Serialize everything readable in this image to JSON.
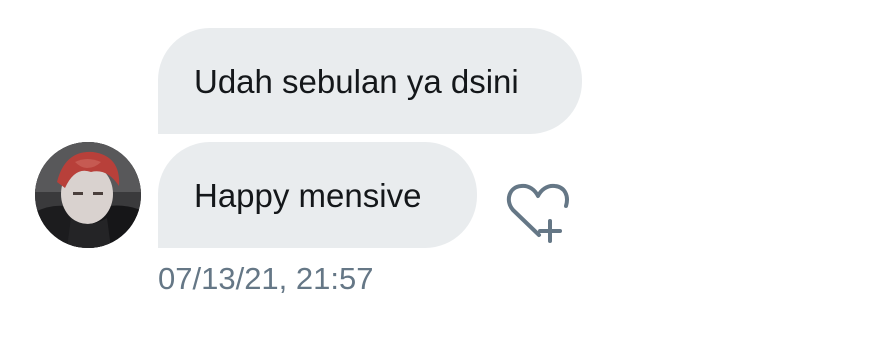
{
  "conversation": {
    "messages": [
      {
        "text": "Udah sebulan ya dsini"
      },
      {
        "text": "Happy mensive"
      }
    ],
    "timestamp": "07/13/21, 21:57"
  },
  "icons": {
    "avatar": "user-avatar-photo",
    "like": "heart-plus-icon"
  },
  "colors": {
    "bubble_background": "#e9ecee",
    "message_text": "#14171a",
    "timestamp_text": "#657786",
    "icon_stroke": "#657786"
  }
}
